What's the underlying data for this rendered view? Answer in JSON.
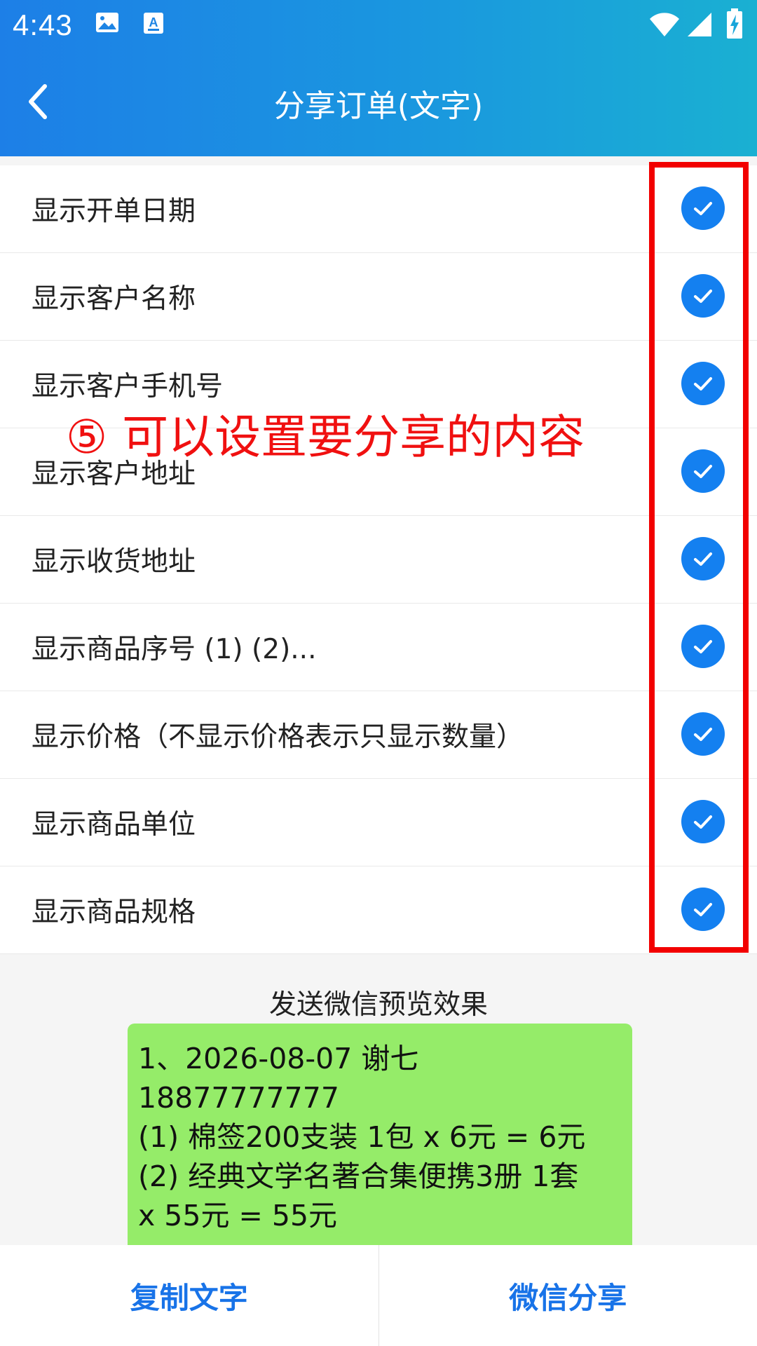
{
  "status_bar": {
    "time": "4:43",
    "left_icons": [
      "image-icon",
      "keyboard-a-icon"
    ],
    "right_icons": [
      "wifi-icon",
      "signal-icon",
      "battery-charging-icon"
    ]
  },
  "header": {
    "title": "分享订单(文字)",
    "back_icon": "chevron-left-icon",
    "gradient_start": "#1d7fe7",
    "gradient_end": "#1ab0d2"
  },
  "options": [
    {
      "label": "显示开单日期",
      "checked": true
    },
    {
      "label": "显示客户名称",
      "checked": true
    },
    {
      "label": "显示客户手机号",
      "checked": true
    },
    {
      "label": "显示客户地址",
      "checked": true
    },
    {
      "label": "显示收货地址",
      "checked": true
    },
    {
      "label": "显示商品序号 (1) (2)...",
      "checked": true
    },
    {
      "label": "显示价格（不显示价格表示只显示数量）",
      "checked": true
    },
    {
      "label": "显示商品单位",
      "checked": true
    },
    {
      "label": "显示商品规格",
      "checked": true
    }
  ],
  "annotation": {
    "text": "⑤ 可以设置要分享的内容",
    "color": "#f01010"
  },
  "preview": {
    "title": "发送微信预览效果",
    "bubble_color": "#95ec69",
    "lines": [
      "1、2026-08-07 谢七",
      "18877777777",
      "(1) 棉签200支装 1包 x 6元 = 6元",
      "(2) 经典文学名著合集便携3册 1套",
      "x 55元 = 55元"
    ]
  },
  "bottom_bar": {
    "copy_label": "复制文字",
    "share_label": "微信分享",
    "accent_color": "#1873e8"
  },
  "check_color": "#1480f0"
}
